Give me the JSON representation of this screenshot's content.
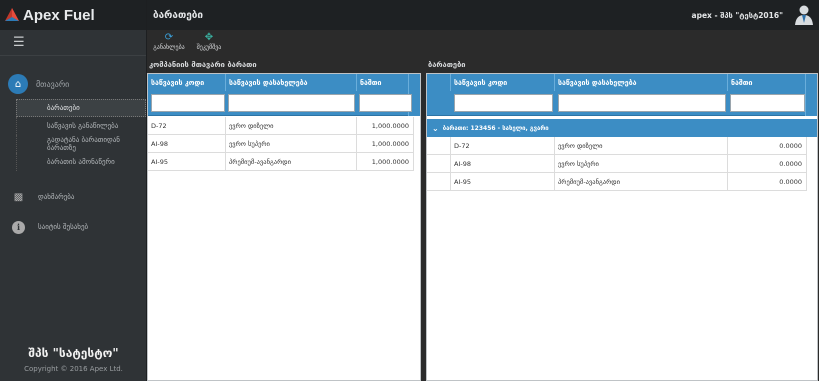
{
  "brand": {
    "name": "Apex Fuel"
  },
  "header": {
    "title": "ბარათები",
    "user": "apex - შპს \"ტესტ2016\""
  },
  "sidebar": {
    "section_label": "მთავარი",
    "sub_items": [
      {
        "label": "ბარათები",
        "active": true
      },
      {
        "label": "საწვავის განაწილება",
        "active": false
      },
      {
        "label": "გადატანა ბარათიდან ბარათზე",
        "active": false
      },
      {
        "label": "ბარათის ამონაწერი",
        "active": false
      }
    ],
    "support_label": "დახმარება",
    "about_label": "საიტის შესახებ",
    "company": "შპს \"სატესტო\"",
    "copyright": "Copyright © 2016 Apex Ltd."
  },
  "toolbar": {
    "refresh_label": "განახლება",
    "move_label": "შეკუმშვა"
  },
  "left_panel": {
    "title": "კომპანიის მთავარი ბარათი",
    "columns": [
      "საწვავის კოდი",
      "საწვავის დასახელება",
      "ნაშთი"
    ],
    "rows": [
      {
        "code": "D-72",
        "name": "ევრო დიზელი",
        "balance": "1,000.0000"
      },
      {
        "code": "AI-98",
        "name": "ევრო სუპერი",
        "balance": "1,000.0000"
      },
      {
        "code": "AI-95",
        "name": "პრემიუმ-ავანგარდი",
        "balance": "1,000.0000"
      }
    ]
  },
  "right_panel": {
    "title": "ბარათები",
    "columns": [
      "საწვავის კოდი",
      "საწვავის დასახელება",
      "ნაშთი"
    ],
    "group_label": "ბარათი: 123456 - სახელი, გვარი",
    "rows": [
      {
        "code": "D-72",
        "name": "ევრო დიზელი",
        "balance": "0.0000"
      },
      {
        "code": "AI-98",
        "name": "ევრო სუპერი",
        "balance": "0.0000"
      },
      {
        "code": "AI-95",
        "name": "პრემიუმ-ავანგარდი",
        "balance": "0.0000"
      }
    ]
  }
}
